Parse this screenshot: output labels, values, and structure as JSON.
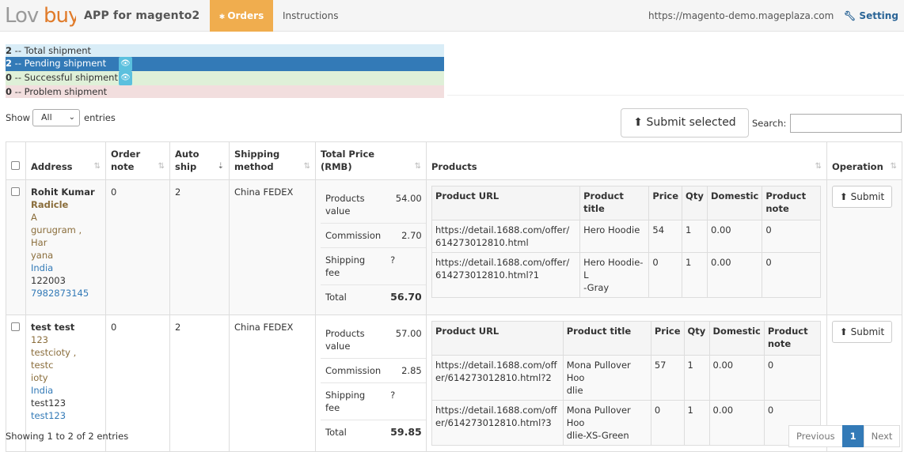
{
  "header": {
    "logo_text": "Lovbuy",
    "app_title": "APP for magento2",
    "nav_orders": "Orders",
    "nav_instructions": "Instructions",
    "site_url": "https://magento-demo.mageplaza.com",
    "setting": "Setting"
  },
  "stats": {
    "total_count": "2",
    "total_label": " -- Total shipment",
    "pending_count": "2",
    "pending_label": " -- Pending shipment",
    "success_count": "0",
    "success_label": " -- Successful shipment",
    "problem_count": "0",
    "problem_label": " -- Problem shipment"
  },
  "controls": {
    "show_label": "Show",
    "show_value": "All",
    "entries_label": "entries",
    "submit_selected": "Submit selected",
    "search_label": "Search:"
  },
  "table": {
    "headers": {
      "address": "Address",
      "order_note_1": "Order",
      "order_note_2": "note",
      "auto_ship_1": "Auto",
      "auto_ship_2": "ship",
      "shipping_1": "Shipping",
      "shipping_2": "method",
      "total_1": "Total Price",
      "total_2": "(RMB)",
      "products": "Products",
      "operation": "Operation"
    },
    "product_headers": {
      "url": "Product URL",
      "title": "Product title",
      "price": "Price",
      "qty": "Qty",
      "domestic": "Domestic",
      "note_1": "Product",
      "note_2": "note"
    },
    "price_labels": {
      "products_value_1": "Products",
      "products_value_2": "value",
      "commission": "Commission",
      "shipping_fee": "Shipping fee",
      "total": "Total"
    },
    "rows": [
      {
        "name_1": "Rohit Kumar",
        "name_2": "Radicle",
        "addr_1": "A",
        "addr_2": "gurugram , Har",
        "addr_3": "yana",
        "country": "India",
        "zip": "122003",
        "phone": "7982873145",
        "order_note": "0",
        "auto_ship": "2",
        "shipping_method": "China FEDEX",
        "products_value": "54.00",
        "commission": "2.70",
        "shipping_fee": "?",
        "total": "56.70",
        "products": [
          {
            "url_1": "https://detail.1688.com/offer/",
            "url_2": "614273012810.html",
            "title_1": "Hero Hoodie",
            "title_2": "",
            "price": "54",
            "qty": "1",
            "domestic": "0.00",
            "note": "0"
          },
          {
            "url_1": "https://detail.1688.com/offer/",
            "url_2": "614273012810.html?1",
            "title_1": "Hero Hoodie-L",
            "title_2": "-Gray",
            "price": "0",
            "qty": "1",
            "domestic": "0.00",
            "note": "0"
          }
        ],
        "submit": "Submit"
      },
      {
        "name_1": "test test",
        "addr_1": "123",
        "addr_2": "testcioty , testc",
        "addr_3": "ioty",
        "country": "India",
        "zip": "test123",
        "phone": "test123",
        "order_note": "0",
        "auto_ship": "2",
        "shipping_method": "China FEDEX",
        "products_value": "57.00",
        "commission": "2.85",
        "shipping_fee": "?",
        "total": "59.85",
        "products": [
          {
            "url_1": "https://detail.1688.com/off",
            "url_2": "er/614273012810.html?2",
            "title_1": "Mona Pullover Hoo",
            "title_2": "dlie",
            "price": "57",
            "qty": "1",
            "domestic": "0.00",
            "note": "0"
          },
          {
            "url_1": "https://detail.1688.com/off",
            "url_2": "er/614273012810.html?3",
            "title_1": "Mona Pullover Hoo",
            "title_2": "dlie-XS-Green",
            "price": "0",
            "qty": "1",
            "domestic": "0.00",
            "note": "0"
          }
        ],
        "submit": "Submit"
      }
    ]
  },
  "footer": {
    "info": "Showing 1 to 2 of 2 entries",
    "previous": "Previous",
    "page": "1",
    "next": "Next"
  }
}
